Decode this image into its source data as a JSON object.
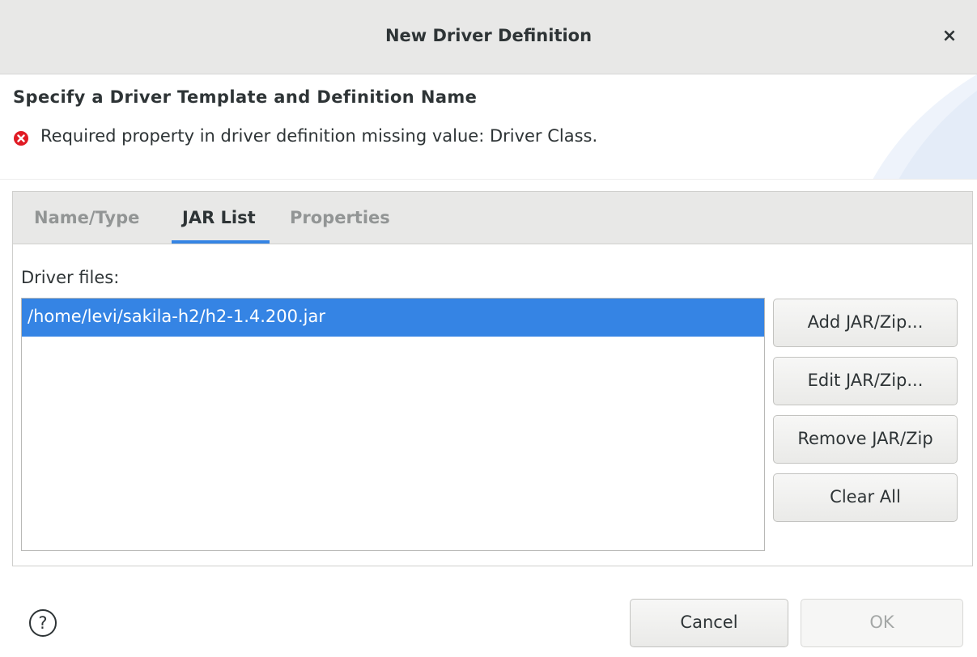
{
  "window": {
    "title": "New Driver Definition",
    "close_glyph": "×"
  },
  "header": {
    "heading": "Specify a Driver Template and Definition Name",
    "message": "Required property in driver definition missing value: Driver Class.",
    "message_icon": "error-icon"
  },
  "tabs": [
    {
      "label": "Name/Type",
      "active": false
    },
    {
      "label": "JAR List",
      "active": true
    },
    {
      "label": "Properties",
      "active": false
    }
  ],
  "jar_list": {
    "label": "Driver files:",
    "files": [
      "/home/levi/sakila-h2/h2-1.4.200.jar"
    ],
    "selected_index": 0
  },
  "side_buttons": {
    "add": "Add JAR/Zip...",
    "edit": "Edit JAR/Zip...",
    "remove": "Remove JAR/Zip",
    "clear": "Clear All"
  },
  "footer": {
    "help_glyph": "?",
    "cancel": "Cancel",
    "ok": "OK"
  },
  "colors": {
    "accent": "#3584e4",
    "error": "#e01b24",
    "titlebar": "#e8e8e7"
  }
}
